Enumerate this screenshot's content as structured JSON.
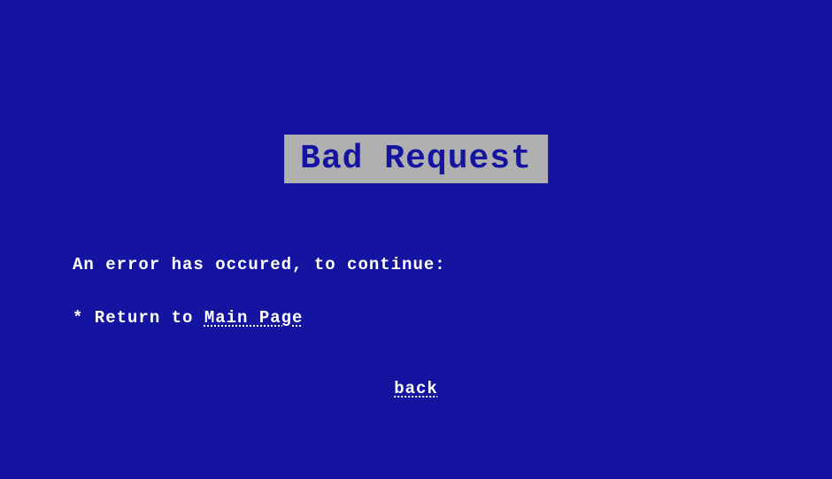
{
  "title": "Bad Request",
  "message": "An error has occured, to continue:",
  "return_prefix": "* Return to ",
  "main_page_link": "Main Page",
  "back_link": "back"
}
